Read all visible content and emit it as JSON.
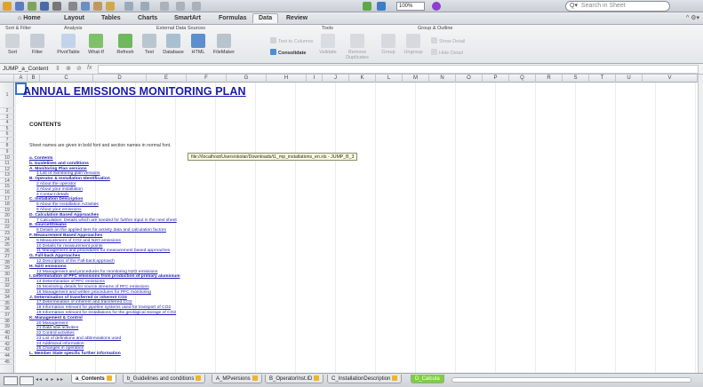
{
  "toolbar": {
    "zoom": "100%",
    "search_placeholder": "Search in Sheet",
    "search_prefix": "Q▾"
  },
  "ribbon_tabs": [
    "Home",
    "Layout",
    "Tables",
    "Charts",
    "SmartArt",
    "Formulas",
    "Data",
    "Review"
  ],
  "active_tab": "Data",
  "ribbon_right": "^ ⚙▾",
  "groups": {
    "sort_filter": "Sort & Filter",
    "analysis": "Analysis",
    "external": "External Data Sources",
    "tools": "Tools",
    "group_outline": "Group & Outline"
  },
  "buttons": {
    "sort": "Sort",
    "filter": "Filter",
    "pivottable": "PivotTable",
    "whatif": "What-If",
    "refresh": "Refresh",
    "text": "Text",
    "database": "Database",
    "html": "HTML",
    "filemaker": "FileMaker",
    "text_to_columns": "Text to Columns",
    "consolidate": "Consolidate",
    "validate": "Validate",
    "remove_duplicates_1": "Remove",
    "remove_duplicates_2": "Duplicates",
    "group": "Group",
    "ungroup": "Ungroup",
    "show_detail": "Show Detail",
    "hide_detail": "Hide Detail"
  },
  "formula_bar": {
    "name_box": "JUMP_a_Content",
    "fx": "fx"
  },
  "columns": [
    "A",
    "B",
    "C",
    "D",
    "E",
    "F",
    "G",
    "H",
    "I",
    "J",
    "K",
    "L",
    "M",
    "N",
    "O",
    "P",
    "Q",
    "R",
    "S",
    "T",
    "U",
    "V"
  ],
  "rows": [
    "1",
    "2",
    "3",
    "4",
    "5",
    "6",
    "7",
    "8",
    "9",
    "10",
    "11",
    "12",
    "13",
    "14",
    "15",
    "16",
    "17",
    "18",
    "19",
    "20",
    "21",
    "22",
    "23",
    "24",
    "25",
    "26",
    "27",
    "28",
    "29",
    "30",
    "31",
    "32",
    "33",
    "34",
    "35",
    "36",
    "37",
    "38",
    "39",
    "40",
    "41",
    "42",
    "43",
    "44",
    "45"
  ],
  "sheet": {
    "title": "ANNUAL EMISSIONS MONITORING PLAN",
    "contents_heading": "CONTENTS",
    "intro": "Sheet names are given in bold font and section names in normal font.",
    "tooltip": "file:///localhost/Users/skolar/Downloads/t1_mp_installations_en.xls - JUMP_B_3",
    "toc": [
      {
        "text": "a. Contents",
        "kind": "sec"
      },
      {
        "text": "b. Guidelines and conditions",
        "kind": "sec"
      },
      {
        "text": "A. Monitoring Plan versions",
        "kind": "sec"
      },
      {
        "text": "1  List of monitoring plan versions",
        "kind": "sub"
      },
      {
        "text": "B. Operator & Installation Identification",
        "kind": "sec"
      },
      {
        "text": "2  About the operator",
        "kind": "sub"
      },
      {
        "text": "3  About your installation",
        "kind": "sub"
      },
      {
        "text": "4  Contact details",
        "kind": "sub"
      },
      {
        "text": "C. Installation Description",
        "kind": "sec"
      },
      {
        "text": "5  About the Installation Activities",
        "kind": "sub"
      },
      {
        "text": "6  About your emissions",
        "kind": "sub"
      },
      {
        "text": "D. Calculation Based Approaches",
        "kind": "sec"
      },
      {
        "text": "7  Calculation: Details which are needed for further input in the next sheet",
        "kind": "sub"
      },
      {
        "text": "E. SourceStreams",
        "kind": "sec"
      },
      {
        "text": "8  Details on the applied tiers for activity data and calculation factors",
        "kind": "sub"
      },
      {
        "text": "F. Measurement Based Approaches",
        "kind": "sec"
      },
      {
        "text": "9  Measurement of CO2 and N2O emissions",
        "kind": "sub"
      },
      {
        "text": "10  Details for measurement points",
        "kind": "sub"
      },
      {
        "text": "11  Management and procedures for measurement based approaches",
        "kind": "sub"
      },
      {
        "text": "G. Fall-back Approaches",
        "kind": "sec"
      },
      {
        "text": "12  Description of the Fall-back approach",
        "kind": "sub"
      },
      {
        "text": "H. N2O emissions",
        "kind": "sec"
      },
      {
        "text": "13  Management and procedures for monitoring N2O emissions",
        "kind": "sub"
      },
      {
        "text": "I. Determination of PFC emissions from production of primary aluminium",
        "kind": "sec"
      },
      {
        "text": "14  Determination of PFC emissions",
        "kind": "sub"
      },
      {
        "text": "15  Monitoring details for source streams of PFC emissions",
        "kind": "sub"
      },
      {
        "text": "16  Management and written procedures for PFC monitoring",
        "kind": "sub"
      },
      {
        "text": "J. Determination of transferred or inherent CO2",
        "kind": "sec"
      },
      {
        "text": "17  Determination of inherent and transferred CO2",
        "kind": "sub"
      },
      {
        "text": "18  Information relevant for pipeline systems used for transport of CO2",
        "kind": "sub"
      },
      {
        "text": "19  Information relevant for installations for the geological storage of CO2",
        "kind": "sub"
      },
      {
        "text": "K. Management & Control",
        "kind": "sec"
      },
      {
        "text": "20  Management",
        "kind": "sub"
      },
      {
        "text": "21  Data flow activities",
        "kind": "sub"
      },
      {
        "text": "22  Control activities",
        "kind": "sub"
      },
      {
        "text": "23  List of definitions and abbreviations used",
        "kind": "sub"
      },
      {
        "text": "24  Additional information",
        "kind": "sub"
      },
      {
        "text": "25  Changes in operation",
        "kind": "sub"
      },
      {
        "text": "L. Member State specific further information",
        "kind": "sec"
      }
    ]
  },
  "sheet_tabs": [
    {
      "label": "a_Contents",
      "active": true
    },
    {
      "label": "b_Guidelines and conditions",
      "active": false
    },
    {
      "label": "A_MPversions",
      "active": false
    },
    {
      "label": "B_OperatorInst.ID",
      "active": false
    },
    {
      "label": "C_InstallationDescription",
      "active": false
    },
    {
      "label": "D_Calcula",
      "active": false
    }
  ],
  "colors": {
    "accent": "#3b6fd1",
    "link": "#1f1fb2",
    "title": "#1a1aa6",
    "tab_green": "#7cd13a"
  }
}
